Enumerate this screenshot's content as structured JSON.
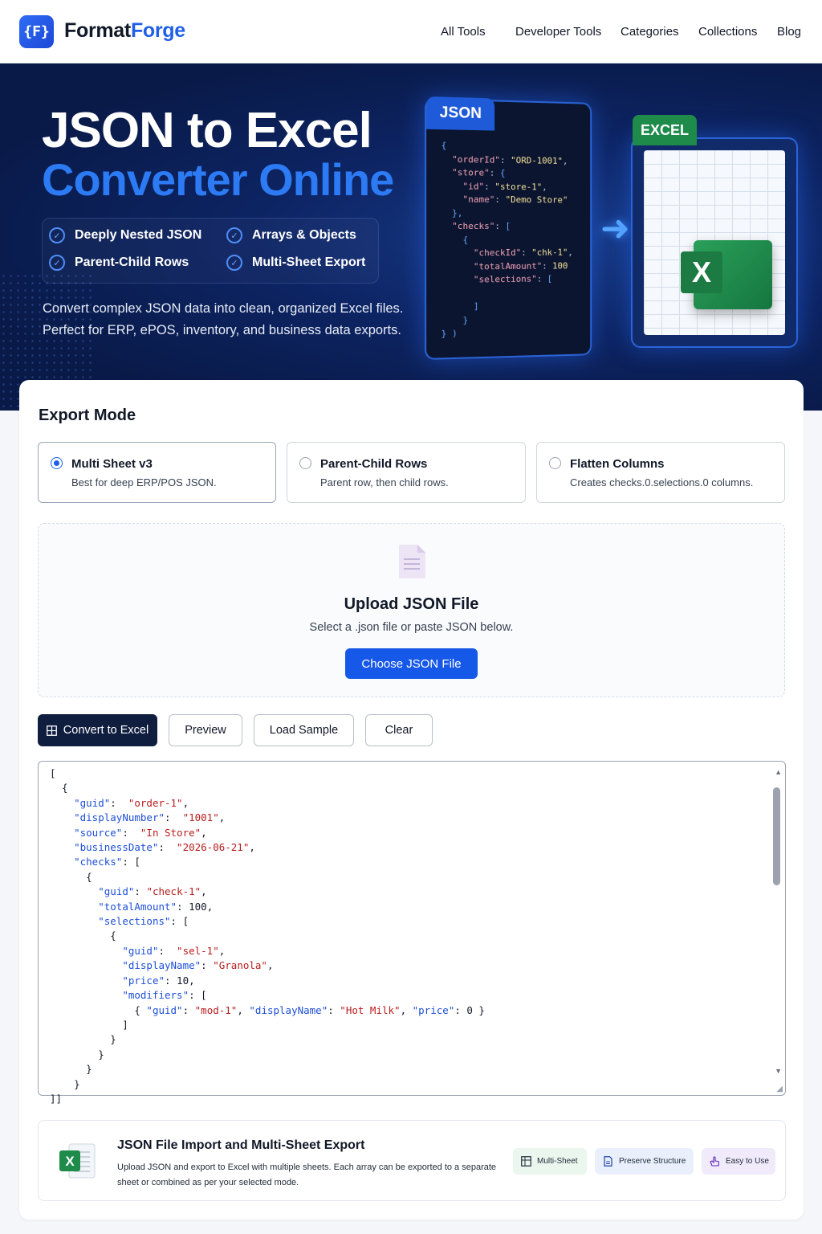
{
  "header": {
    "logo_glyph": "{F}",
    "brand_part1": "Format",
    "brand_part2": "Forge",
    "nav": [
      "All Tools",
      "Developer Tools",
      "Categories",
      "Collections",
      "Blog"
    ]
  },
  "hero": {
    "title_line1": "JSON to Excel",
    "title_line2": "Converter Online",
    "features": [
      "Deeply Nested JSON",
      "Arrays & Objects",
      "Parent-Child Rows",
      "Multi-Sheet Export"
    ],
    "desc_line1": "Convert complex JSON data into clean, organized Excel files.",
    "desc_line2": "Perfect for ERP, ePOS, inventory, and business data exports.",
    "json_label": "JSON",
    "excel_label": "EXCEL",
    "excel_letter": "X"
  },
  "export_mode": {
    "title": "Export Mode",
    "options": [
      {
        "name": "Multi Sheet v3",
        "desc": "Best for deep ERP/POS JSON.",
        "selected": true
      },
      {
        "name": "Parent-Child Rows",
        "desc": "Parent row, then child rows.",
        "selected": false
      },
      {
        "name": "Flatten Columns",
        "desc": "Creates checks.0.selections.0 columns.",
        "selected": false
      }
    ]
  },
  "upload": {
    "title": "Upload JSON File",
    "subtitle": "Select a .json file or paste JSON below.",
    "button": "Choose JSON File"
  },
  "actions": {
    "convert": "Convert to Excel",
    "preview": "Preview",
    "load_sample": "Load Sample",
    "clear": "Clear"
  },
  "info": {
    "title": "JSON File Import and Multi-Sheet Export",
    "desc": "Upload JSON and export to Excel with multiple sheets. Each array can be exported to a separate sheet or combined as per your selected mode.",
    "chips": [
      "Multi-Sheet",
      "Preserve Structure",
      "Easy to Use"
    ]
  },
  "colors": {
    "accent": "#1f5fe8",
    "hero_bg": "#0d2463",
    "excel_green": "#1e8b4b",
    "dark_button": "#0f1d3f"
  }
}
